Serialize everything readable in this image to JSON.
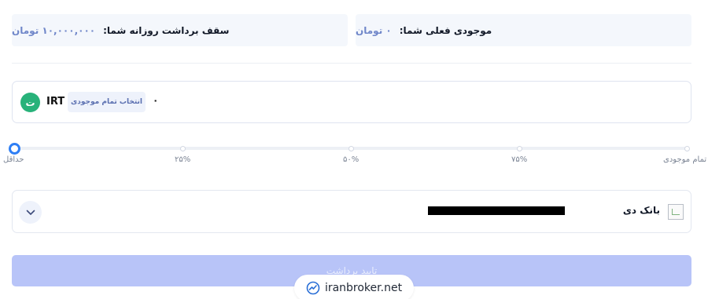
{
  "balance_card": {
    "label": "موجودی فعلی شما:",
    "value": "۰ تومان"
  },
  "limit_card": {
    "label": "سقف برداشت روزانه شما:",
    "value": "۱۰,۰۰۰,۰۰۰ تومان"
  },
  "amount": {
    "currency_symbol": "ت",
    "currency_code": "IRT",
    "select_all_label": "انتخاب تمام موجودی",
    "value": "۰"
  },
  "slider": {
    "level_percent": 0,
    "labels": {
      "min": "حداقل",
      "p25": "۲۵%",
      "p50": "۵۰%",
      "p75": "۷۵%",
      "max": "تمام موجودی"
    }
  },
  "bank": {
    "name": "بانک دی",
    "account_masked": true
  },
  "submit": {
    "label": "تایید برداشت"
  },
  "watermark": {
    "text": "iranbroker.net"
  },
  "colors": {
    "accent": "#2f7ff5",
    "currency": "#28b27a",
    "submit_disabled": "#b8c4f8",
    "value_text": "#6f86c9"
  }
}
